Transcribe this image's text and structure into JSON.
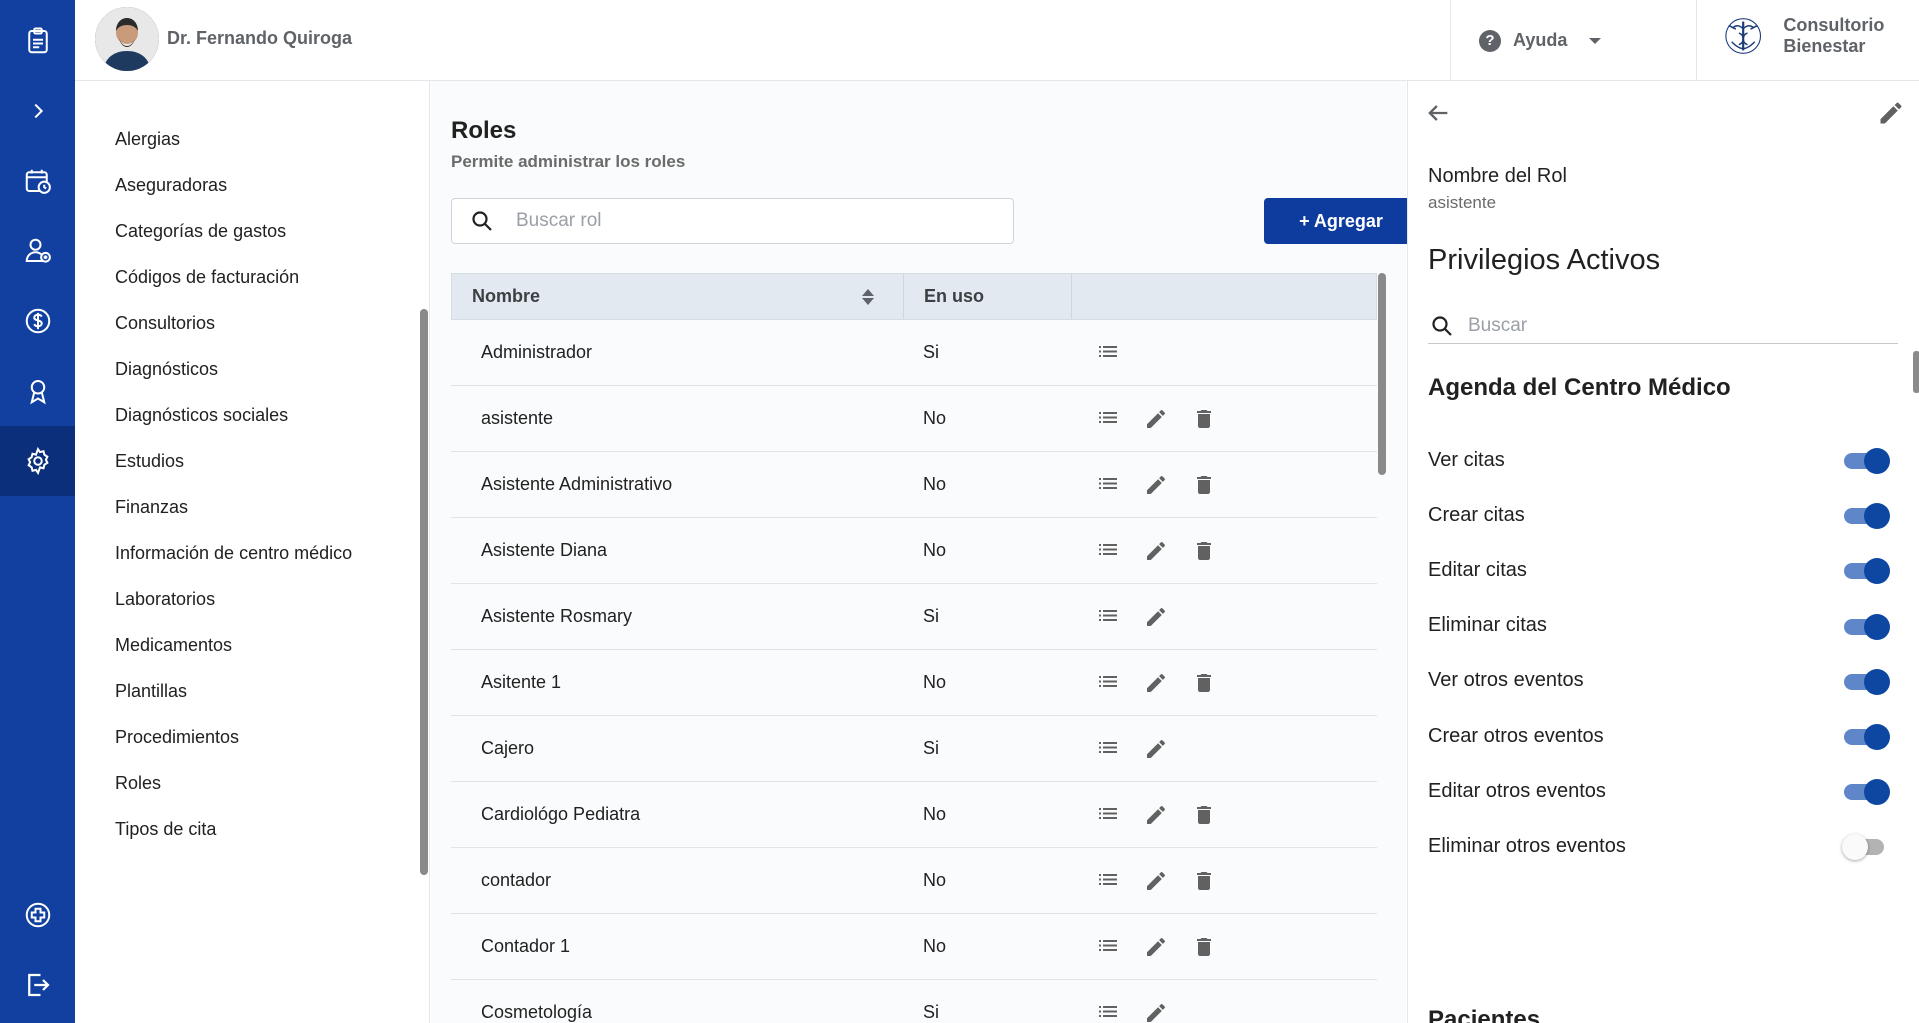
{
  "rail": {
    "items": [
      {
        "icon": "clipboard-list-icon"
      },
      {
        "icon": "chevron-right-icon"
      },
      {
        "icon": "calendar-clock-icon"
      },
      {
        "icon": "patient-add-icon"
      },
      {
        "icon": "dollar-circle-icon"
      },
      {
        "icon": "award-ribbon-icon"
      },
      {
        "icon": "gear-icon",
        "active": true
      },
      {
        "icon": "medical-cross-icon"
      },
      {
        "icon": "logout-icon"
      }
    ],
    "color": "#1140a0",
    "active_color": "#0b2f7a"
  },
  "header": {
    "doctor_name": "Dr. Fernando Quiroga",
    "help_label": "Ayuda",
    "clinic_name": "Consultorio Bienestar"
  },
  "settings_menu": {
    "items": [
      "Alergias",
      "Aseguradoras",
      "Categorías de gastos",
      "Códigos de facturación",
      "Consultorios",
      "Diagnósticos",
      "Diagnósticos sociales",
      "Estudios",
      "Finanzas",
      "Información de centro médico",
      "Laboratorios",
      "Medicamentos",
      "Plantillas",
      "Procedimientos",
      "Roles",
      "Tipos de cita"
    ]
  },
  "main": {
    "title": "Roles",
    "subtitle": "Permite administrar los roles",
    "search_placeholder": "Buscar rol",
    "add_label": "+ Agregar",
    "columns": [
      "Nombre",
      "En uso",
      ""
    ],
    "rows": [
      {
        "name": "Administrador",
        "in_use": "Si",
        "edit": false,
        "delete": false
      },
      {
        "name": "asistente",
        "in_use": "No",
        "edit": true,
        "delete": true
      },
      {
        "name": "Asistente Administrativo",
        "in_use": "No",
        "edit": true,
        "delete": true
      },
      {
        "name": "Asistente Diana",
        "in_use": "No",
        "edit": true,
        "delete": true
      },
      {
        "name": "Asistente Rosmary",
        "in_use": "Si",
        "edit": true,
        "delete": false
      },
      {
        "name": "Asitente 1",
        "in_use": "No",
        "edit": true,
        "delete": true
      },
      {
        "name": "Cajero",
        "in_use": "Si",
        "edit": true,
        "delete": false
      },
      {
        "name": "Cardiológo Pediatra",
        "in_use": "No",
        "edit": true,
        "delete": true
      },
      {
        "name": "contador",
        "in_use": "No",
        "edit": true,
        "delete": true
      },
      {
        "name": "Contador 1",
        "in_use": "No",
        "edit": true,
        "delete": true
      },
      {
        "name": "Cosmetología",
        "in_use": "Si",
        "edit": true,
        "delete": false
      }
    ],
    "accent": "#0d3c9e"
  },
  "detail": {
    "role_label": "Nombre del Rol",
    "role_value": "asistente",
    "privileges_title": "Privilegios Activos",
    "search_placeholder": "Buscar",
    "section_title": "Agenda del Centro Médico",
    "next_section_title": "Pacientes",
    "privileges": [
      {
        "label": "Ver citas",
        "enabled": true
      },
      {
        "label": "Crear citas",
        "enabled": true
      },
      {
        "label": "Editar citas",
        "enabled": true
      },
      {
        "label": "Eliminar citas",
        "enabled": true
      },
      {
        "label": "Ver otros eventos",
        "enabled": true
      },
      {
        "label": "Crear otros eventos",
        "enabled": true
      },
      {
        "label": "Editar otros eventos",
        "enabled": true
      },
      {
        "label": "Eliminar otros eventos",
        "enabled": false
      }
    ],
    "toggle_on_color": "#0d47a1"
  }
}
